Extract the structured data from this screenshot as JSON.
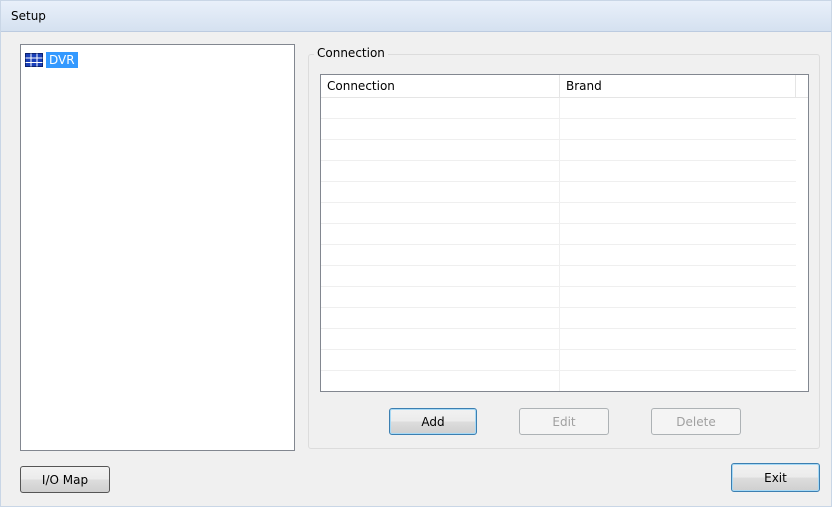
{
  "window": {
    "title": "Setup"
  },
  "tree": {
    "root": {
      "label": "DVR",
      "icon": "dvr-grid-icon",
      "selected": true
    }
  },
  "connection_group": {
    "legend": "Connection",
    "columns": [
      "Connection",
      "Brand"
    ],
    "rows": []
  },
  "buttons": {
    "add": "Add",
    "edit": "Edit",
    "delete": "Delete",
    "io_map": "I/O Map",
    "exit": "Exit"
  },
  "colors": {
    "selection": "#3399ff",
    "default_button_border": "#3c7fb1"
  }
}
